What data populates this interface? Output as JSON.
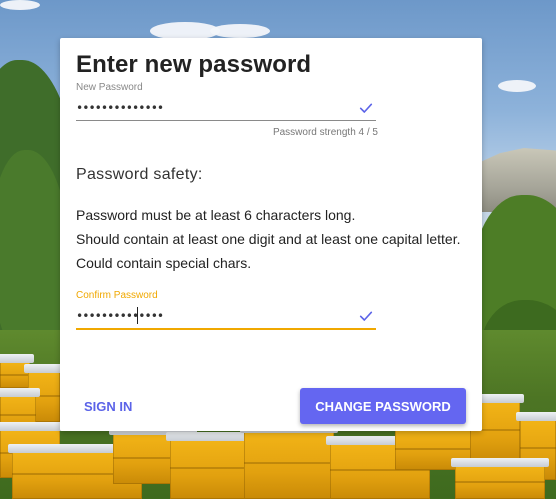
{
  "form": {
    "title": "Enter new password",
    "new_password": {
      "label": "New Password",
      "value": "••••••••••••••",
      "valid": true
    },
    "strength_text": "Password strength 4 / 5",
    "safety": {
      "heading": "Password safety:",
      "rules": [
        "Password must be at least 6 characters long.",
        "Should contain at least one digit and at least one capital letter.",
        "Could contain special chars."
      ]
    },
    "confirm_password": {
      "label": "Confirm Password",
      "value": "••••••••••••••",
      "valid": true,
      "focused": true
    }
  },
  "actions": {
    "sign_in": "SIGN IN",
    "change_password": "CHANGE PASSWORD"
  },
  "colors": {
    "accent": "#6466f1",
    "link": "#5b63e8",
    "focus_underline": "#f0a800",
    "check_icon": "#5b63e8"
  },
  "icons": {
    "new_password_status": "checkmark-icon",
    "confirm_password_status": "checkmark-icon"
  },
  "background": {
    "scene": "apiary-beehives-landscape"
  }
}
